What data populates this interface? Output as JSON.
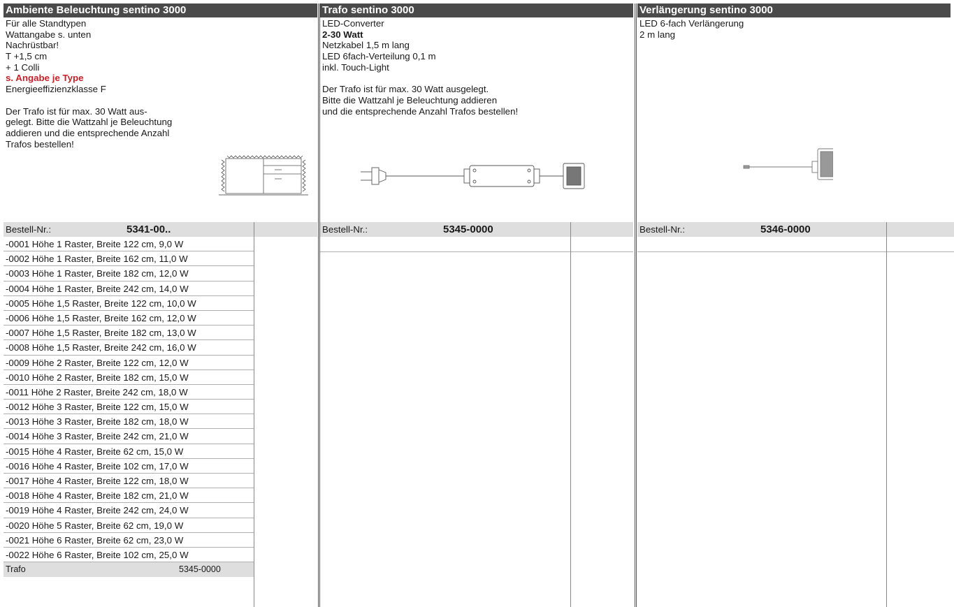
{
  "columns": [
    {
      "title": "Ambiente Beleuchtung sentino 3000",
      "desc": [
        "Für alle Standtypen",
        "Wattangabe s. unten",
        "Nachrüstbar!",
        "T +1,5 cm",
        "+ 1 Colli"
      ],
      "highlight": "s. Angabe je Type",
      "desc2": [
        "Energieeffizienzklasse F"
      ],
      "note": [
        "Der Trafo ist für max. 30 Watt aus-",
        "gelegt. Bitte die Wattzahl je Beleuchtung",
        "addieren und die entsprechende Anzahl",
        "Trafos bestellen!"
      ],
      "order_label": "Bestell-Nr.:",
      "order_number": "5341-00..",
      "variants": [
        "-0001 Höhe 1 Raster, Breite 122 cm, 9,0 W",
        "-0002 Höhe 1 Raster, Breite 162 cm, 11,0 W",
        "-0003 Höhe 1 Raster, Breite 182 cm, 12,0 W",
        "-0004 Höhe 1 Raster, Breite 242 cm, 14,0 W",
        "-0005 Höhe 1,5 Raster, Breite 122 cm, 10,0 W",
        "-0006 Höhe 1,5 Raster, Breite 162 cm, 12,0 W",
        "-0007 Höhe 1,5 Raster, Breite 182 cm, 13,0 W",
        "-0008 Höhe 1,5 Raster, Breite 242 cm, 16,0 W",
        "-0009 Höhe 2 Raster, Breite 122 cm, 12,0 W",
        "-0010 Höhe 2 Raster, Breite 182 cm, 15,0 W",
        "-0011 Höhe 2 Raster, Breite 242 cm, 18,0 W",
        "-0012 Höhe 3 Raster, Breite 122 cm, 15,0 W",
        "-0013 Höhe 3 Raster, Breite 182 cm, 18,0 W",
        "-0014 Höhe 3 Raster, Breite 242 cm, 21,0 W",
        "-0015 Höhe 4 Raster, Breite 62 cm, 15,0 W",
        "-0016 Höhe 4 Raster, Breite 102 cm, 17,0 W",
        "-0017 Höhe 4 Raster, Breite 122 cm, 18,0 W",
        "-0018 Höhe 4 Raster, Breite 182 cm, 21,0 W",
        "-0019 Höhe 4 Raster, Breite 242 cm, 24,0 W",
        "-0020 Höhe 5 Raster, Breite 62 cm, 19,0 W",
        "-0021 Höhe 6 Raster, Breite 62 cm, 23,0 W",
        "-0022 Höhe 6 Raster, Breite 102 cm, 25,0 W"
      ],
      "trafo_label": "Trafo",
      "trafo_number": "5345-0000",
      "illustration": "sideboard-with-led-strips"
    },
    {
      "title": "Trafo sentino 3000",
      "desc": [
        "LED-Converter"
      ],
      "wattage": "2-30 Watt",
      "desc2": [
        "Netzkabel 1,5 m lang",
        "LED 6fach-Verteilung 0,1 m",
        "inkl. Touch-Light"
      ],
      "note": [
        "Der Trafo ist für max. 30 Watt ausgelegt.",
        "Bitte die Wattzahl je Beleuchtung addieren",
        "und die entsprechende Anzahl Trafos bestellen!"
      ],
      "order_label": "Bestell-Nr.:",
      "order_number": "5345-0000",
      "illustration": "led-converter-with-plug"
    },
    {
      "title": "Verlängerung sentino 3000",
      "desc": [
        "LED 6-fach Verlängerung",
        "2 m lang"
      ],
      "order_label": "Bestell-Nr.:",
      "order_number": "5346-0000",
      "illustration": "extension-cable"
    }
  ]
}
